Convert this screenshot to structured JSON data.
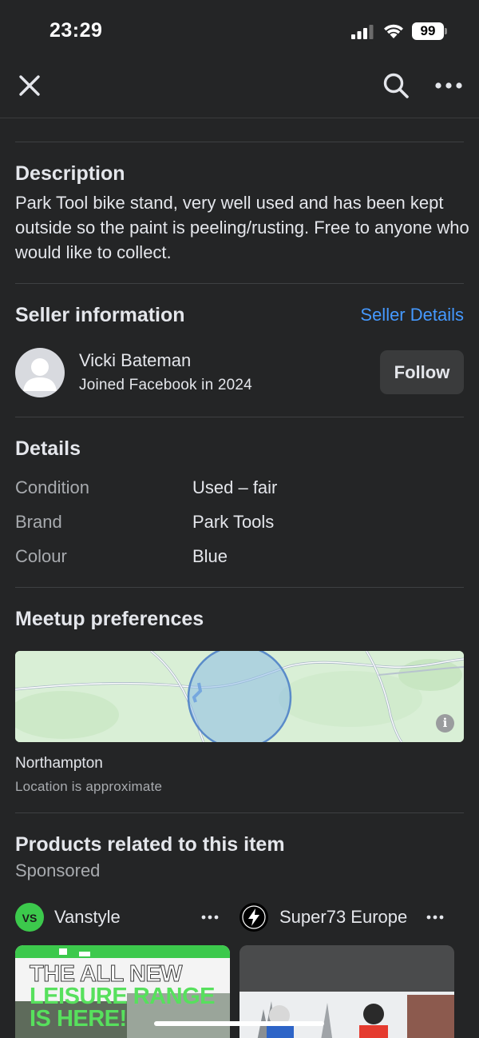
{
  "status_bar": {
    "time": "23:29",
    "battery": "99",
    "icons": [
      "signal-icon",
      "wifi-icon",
      "battery-icon"
    ]
  },
  "nav": {
    "icons": [
      "close-icon",
      "search-icon",
      "more-icon"
    ]
  },
  "description": {
    "title": "Description",
    "text": "Park Tool bike stand, very well used and has been kept outside so the paint is peeling/rusting. Free to anyone who would like to collect."
  },
  "seller": {
    "title": "Seller information",
    "details_link": "Seller Details",
    "name": "Vicki Bateman",
    "joined": "Joined Facebook in 2024",
    "follow_label": "Follow"
  },
  "details": {
    "title": "Details",
    "rows": [
      {
        "label": "Condition",
        "value": "Used – fair"
      },
      {
        "label": "Brand",
        "value": "Park Tools"
      },
      {
        "label": "Colour",
        "value": "Blue"
      }
    ]
  },
  "meetup": {
    "title": "Meetup preferences",
    "location": "Northampton",
    "note": "Location is approximate",
    "info_glyph": "i"
  },
  "related": {
    "title": "Products related to this item",
    "sponsored": "Sponsored",
    "ads": [
      {
        "advertiser": "Vanstyle",
        "logo_text": "VS",
        "headline": [
          "THE ALL NEW",
          "LEISURE RANGE",
          "IS HERE!"
        ]
      },
      {
        "advertiser": "Super73 Europe"
      }
    ]
  },
  "colors": {
    "background": "#242526",
    "text": "#e4e6eb",
    "secondary_text": "#a8abaf",
    "link": "#4599ff",
    "button": "#3a3b3c",
    "vanstyle_green": "#3cc94c"
  }
}
